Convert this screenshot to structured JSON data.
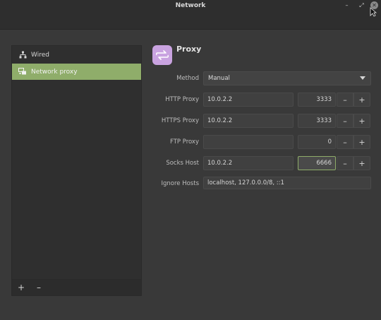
{
  "window": {
    "title": "Network",
    "controls": {
      "minimize": "–",
      "maximize": "⤢",
      "close": "✕"
    }
  },
  "sidebar": {
    "items": [
      {
        "label": "Wired",
        "icon": "network-wired-icon"
      },
      {
        "label": "Network proxy",
        "icon": "network-proxy-icon",
        "selected": true
      }
    ],
    "actions": {
      "add": "+",
      "remove": "–"
    }
  },
  "panel": {
    "title": "Proxy",
    "icon": "proxy-icon",
    "method": {
      "label": "Method",
      "value": "Manual"
    },
    "http": {
      "label": "HTTP Proxy",
      "host": "10.0.2.2",
      "port": "3333"
    },
    "https": {
      "label": "HTTPS Proxy",
      "host": "10.0.2.2",
      "port": "3333"
    },
    "ftp": {
      "label": "FTP Proxy",
      "host": "",
      "port": "0"
    },
    "socks": {
      "label": "Socks Host",
      "host": "10.0.2.2",
      "port": "6666"
    },
    "ignore": {
      "label": "Ignore Hosts",
      "value": "localhost, 127.0.0.0/8, ::1"
    },
    "stepper": {
      "minus": "–",
      "plus": "+"
    }
  },
  "colors": {
    "accent": "#8fad6a",
    "proxy_icon_bg": "#c9a3e0",
    "background": "#393939"
  }
}
